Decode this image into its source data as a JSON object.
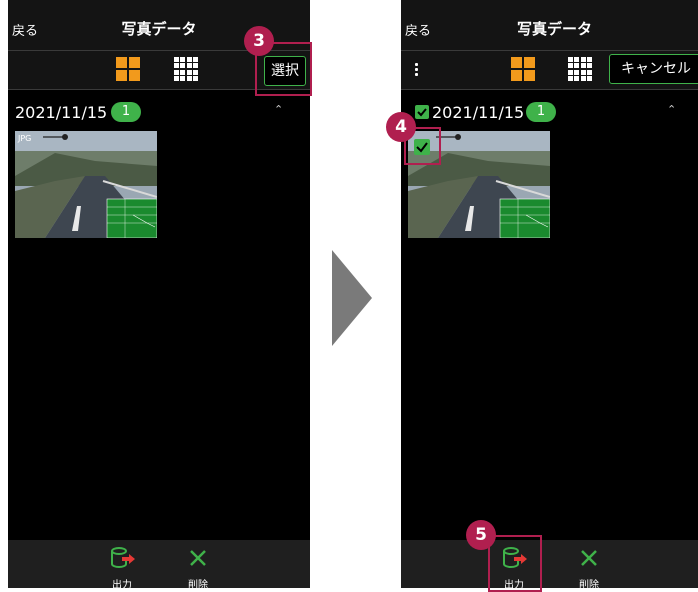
{
  "left_screen": {
    "back_label": "戻る",
    "title": "写真データ",
    "select_label": "選択",
    "date": "2021/11/15",
    "count": "1",
    "callout": "3",
    "thumb_label": "JPG",
    "bottom": {
      "export_label": "出力",
      "delete_label": "削除"
    }
  },
  "right_screen": {
    "back_label": "戻る",
    "title": "写真データ",
    "cancel_label": "キャンセル",
    "date": "2021/11/15",
    "count": "1",
    "callout_check": "4",
    "callout_export": "5",
    "bottom": {
      "export_label": "出力",
      "delete_label": "削除"
    }
  },
  "colors": {
    "accent_green": "#3fb24a",
    "callout": "#b01f4f",
    "grid_orange": "#f29a1c"
  },
  "icons": [
    "grid-4-icon",
    "grid-16-icon",
    "chevron-up-icon",
    "export-icon",
    "delete-x-icon",
    "kebab-menu-icon",
    "check-icon",
    "arrow-right-icon"
  ]
}
